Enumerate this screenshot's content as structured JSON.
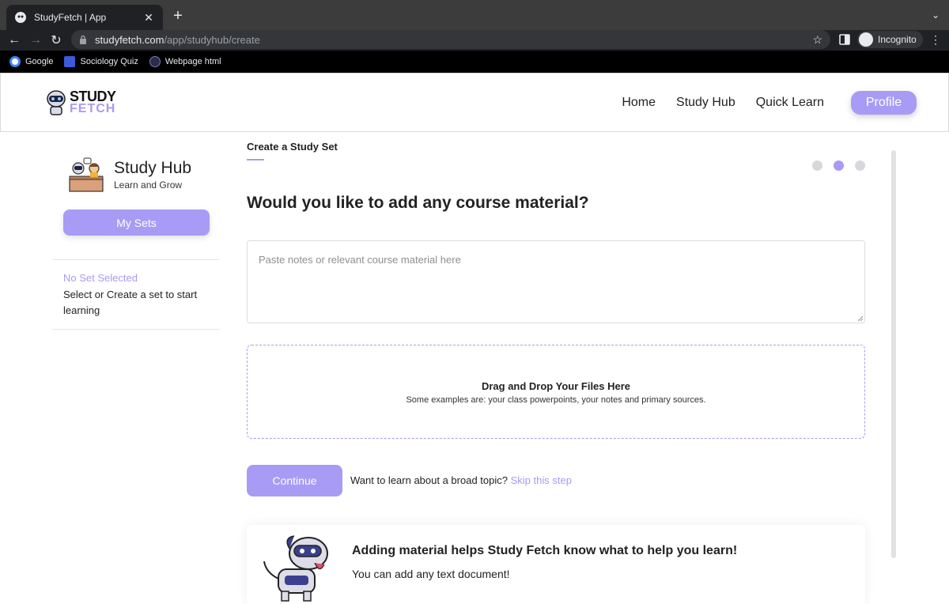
{
  "browser": {
    "tab_title": "StudyFetch | App",
    "tab_close": "✕",
    "new_tab": "+",
    "url_host": "studyfetch.com",
    "url_path": "/app/studyhub/create",
    "incognito_label": "Incognito",
    "bookmarks": [
      {
        "label": "Google",
        "icon": "google-icon",
        "color": "#4285f4"
      },
      {
        "label": "Sociology Quiz",
        "icon": "sociology-quiz-icon",
        "color": "#3b5bdb"
      },
      {
        "label": "Webpage html",
        "icon": "webpage-html-icon",
        "color": "#2b2b4a"
      }
    ]
  },
  "header": {
    "logo_line1": "STUDY",
    "logo_line2": "FETCH",
    "nav": [
      "Home",
      "Study Hub",
      "Quick Learn"
    ],
    "profile_label": "Profile"
  },
  "sidebar": {
    "title": "Study Hub",
    "subtitle": "Learn and Grow",
    "my_sets_label": "My Sets",
    "no_set_label": "No Set Selected",
    "no_set_desc": "Select or Create a set to start learning"
  },
  "main": {
    "step_title": "Create a Study Set",
    "steps": {
      "total": 3,
      "active": 2
    },
    "question": "Would you like to add any course material?",
    "notes_placeholder": "Paste notes or relevant course material here",
    "notes_value": "",
    "dropzone_title": "Drag and Drop Your Files Here",
    "dropzone_sub": "Some examples are: your class powerpoints, your notes and primary sources.",
    "continue_label": "Continue",
    "skip_prompt": "Want to learn about a broad topic?",
    "skip_link": "Skip this step",
    "info_title": "Adding material helps Study Fetch know what to help you learn!",
    "info_sub": "You can add any text document!"
  },
  "colors": {
    "accent": "#a89bf5",
    "text": "#222222",
    "chrome_dark": "#202124"
  }
}
